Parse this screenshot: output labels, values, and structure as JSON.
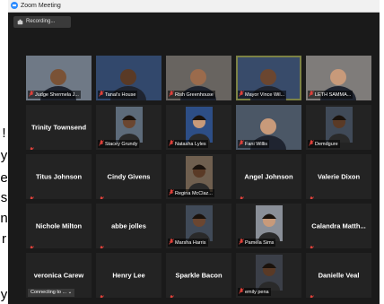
{
  "window": {
    "title": "Zoom Meeting"
  },
  "recording": {
    "label": "Recording..."
  },
  "side_text": [
    "!",
    "y",
    "e",
    "s",
    "n",
    "r",
    "y"
  ],
  "rows": [
    [
      {
        "name": "Judge Shermela J...",
        "kind": "video"
      },
      {
        "name": "Tanai's House",
        "kind": "video"
      },
      {
        "name": "Rish Greenhouse",
        "kind": "video"
      },
      {
        "name": "Mayor Vince Wil...",
        "kind": "video",
        "active": true
      },
      {
        "name": "LETH SAMMA...",
        "kind": "video"
      }
    ],
    [
      {
        "name": "Trinity Townsend",
        "kind": "name"
      },
      {
        "name": "Stacey Grundy",
        "kind": "avatar"
      },
      {
        "name": "Natasha Lyles",
        "kind": "avatar"
      },
      {
        "name": "Fani Willis",
        "kind": "video"
      },
      {
        "name": "Demdgure",
        "kind": "avatar"
      }
    ],
    [
      {
        "name": "Titus Johnson",
        "kind": "name"
      },
      {
        "name": "Cindy Givens",
        "kind": "name"
      },
      {
        "name": "Regina McClaz...",
        "kind": "avatar"
      },
      {
        "name": "Angel Johnson",
        "kind": "name"
      },
      {
        "name": "Valerie Dixon",
        "kind": "name"
      }
    ],
    [
      {
        "name": "Nichole Milton",
        "kind": "name"
      },
      {
        "name": "abbe jolles",
        "kind": "name"
      },
      {
        "name": "Marsha Harris",
        "kind": "avatar"
      },
      {
        "name": "Pamela Sims",
        "kind": "avatar"
      },
      {
        "name": "Calandra Matth...",
        "kind": "name"
      }
    ],
    [
      {
        "name": "veronica Carew",
        "kind": "name",
        "status": "Connecting to ..."
      },
      {
        "name": "Henry Lee",
        "kind": "name"
      },
      {
        "name": "Sparkle Bacon",
        "kind": "name"
      },
      {
        "name": "emily pena",
        "kind": "avatar"
      },
      {
        "name": "Danielle Veal",
        "kind": "name"
      }
    ]
  ],
  "colors": {
    "background": "#1a1a1a",
    "tile": "#232323",
    "active_speaker": "#d6d62a",
    "muted_icon": "#e0413a"
  },
  "icons": {
    "muted": "mic-muted-icon",
    "rec": "recording-icon",
    "app": "zoom-logo-icon",
    "dropdown": "chevron-down-icon"
  }
}
